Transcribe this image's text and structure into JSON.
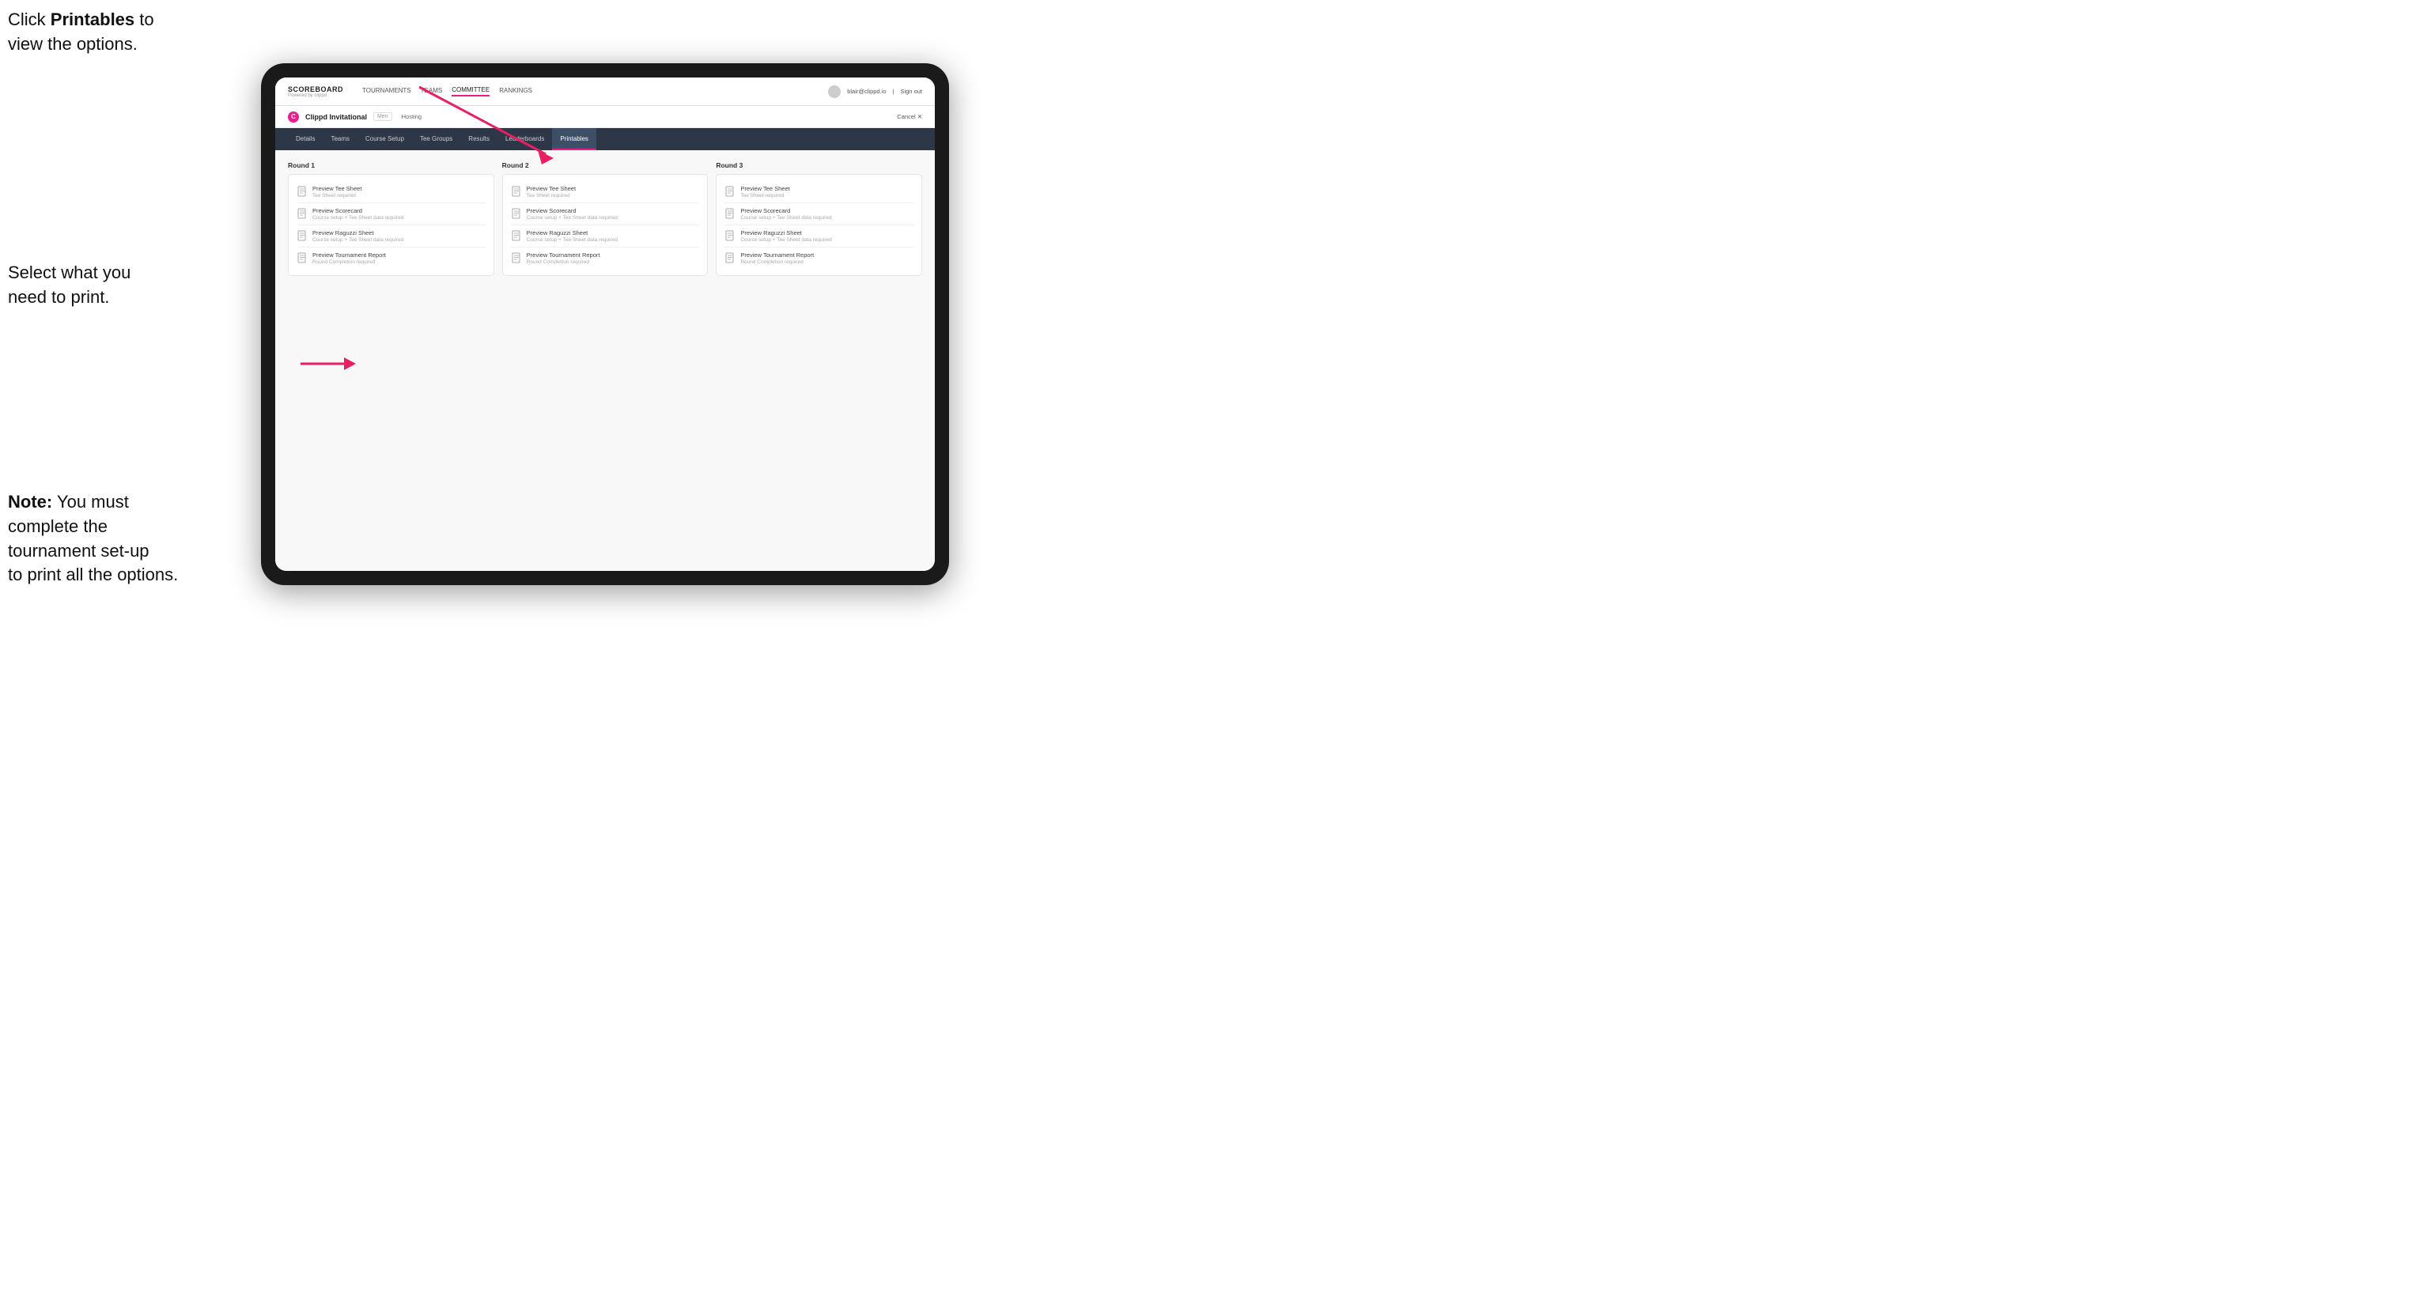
{
  "annotations": {
    "top_line1": "Click ",
    "top_bold": "Printables",
    "top_line2": " to",
    "top_line3": "view the options.",
    "mid_line1": "Select what you",
    "mid_line2": "need to print.",
    "bottom_bold": "Note:",
    "bottom_line1": " You must",
    "bottom_line2": "complete the",
    "bottom_line3": "tournament set-up",
    "bottom_line4": "to print all the options."
  },
  "top_nav": {
    "logo_title": "SCOREBOARD",
    "logo_sub": "Powered by clippd",
    "links": [
      {
        "label": "TOURNAMENTS",
        "active": false
      },
      {
        "label": "TEAMS",
        "active": false
      },
      {
        "label": "COMMITTEE",
        "active": false
      },
      {
        "label": "RANKINGS",
        "active": false
      }
    ],
    "user_email": "blair@clippd.io",
    "sign_out": "Sign out"
  },
  "tournament_header": {
    "icon": "C",
    "name": "Clippd Invitational",
    "tag": "Men",
    "status": "Hosting",
    "cancel": "Cancel ✕"
  },
  "sub_nav_tabs": [
    {
      "label": "Details",
      "active": false
    },
    {
      "label": "Teams",
      "active": false
    },
    {
      "label": "Course Setup",
      "active": false
    },
    {
      "label": "Tee Groups",
      "active": false
    },
    {
      "label": "Results",
      "active": false
    },
    {
      "label": "Leaderboards",
      "active": false
    },
    {
      "label": "Printables",
      "active": true
    }
  ],
  "rounds": [
    {
      "title": "Round 1",
      "items": [
        {
          "title": "Preview Tee Sheet",
          "subtitle": "Tee Sheet required"
        },
        {
          "title": "Preview Scorecard",
          "subtitle": "Course setup + Tee Sheet data required"
        },
        {
          "title": "Preview Raguzzi Sheet",
          "subtitle": "Course setup + Tee Sheet data required"
        },
        {
          "title": "Preview Tournament Report",
          "subtitle": "Round Completion required"
        }
      ]
    },
    {
      "title": "Round 2",
      "items": [
        {
          "title": "Preview Tee Sheet",
          "subtitle": "Tee Sheet required"
        },
        {
          "title": "Preview Scorecard",
          "subtitle": "Course setup + Tee Sheet data required"
        },
        {
          "title": "Preview Raguzzi Sheet",
          "subtitle": "Course setup + Tee Sheet data required"
        },
        {
          "title": "Preview Tournament Report",
          "subtitle": "Round Completion required"
        }
      ]
    },
    {
      "title": "Round 3",
      "items": [
        {
          "title": "Preview Tee Sheet",
          "subtitle": "Tee Sheet required"
        },
        {
          "title": "Preview Scorecard",
          "subtitle": "Course setup + Tee Sheet data required"
        },
        {
          "title": "Preview Raguzzi Sheet",
          "subtitle": "Course setup + Tee Sheet data required"
        },
        {
          "title": "Preview Tournament Report",
          "subtitle": "Round Completion required"
        }
      ]
    }
  ]
}
